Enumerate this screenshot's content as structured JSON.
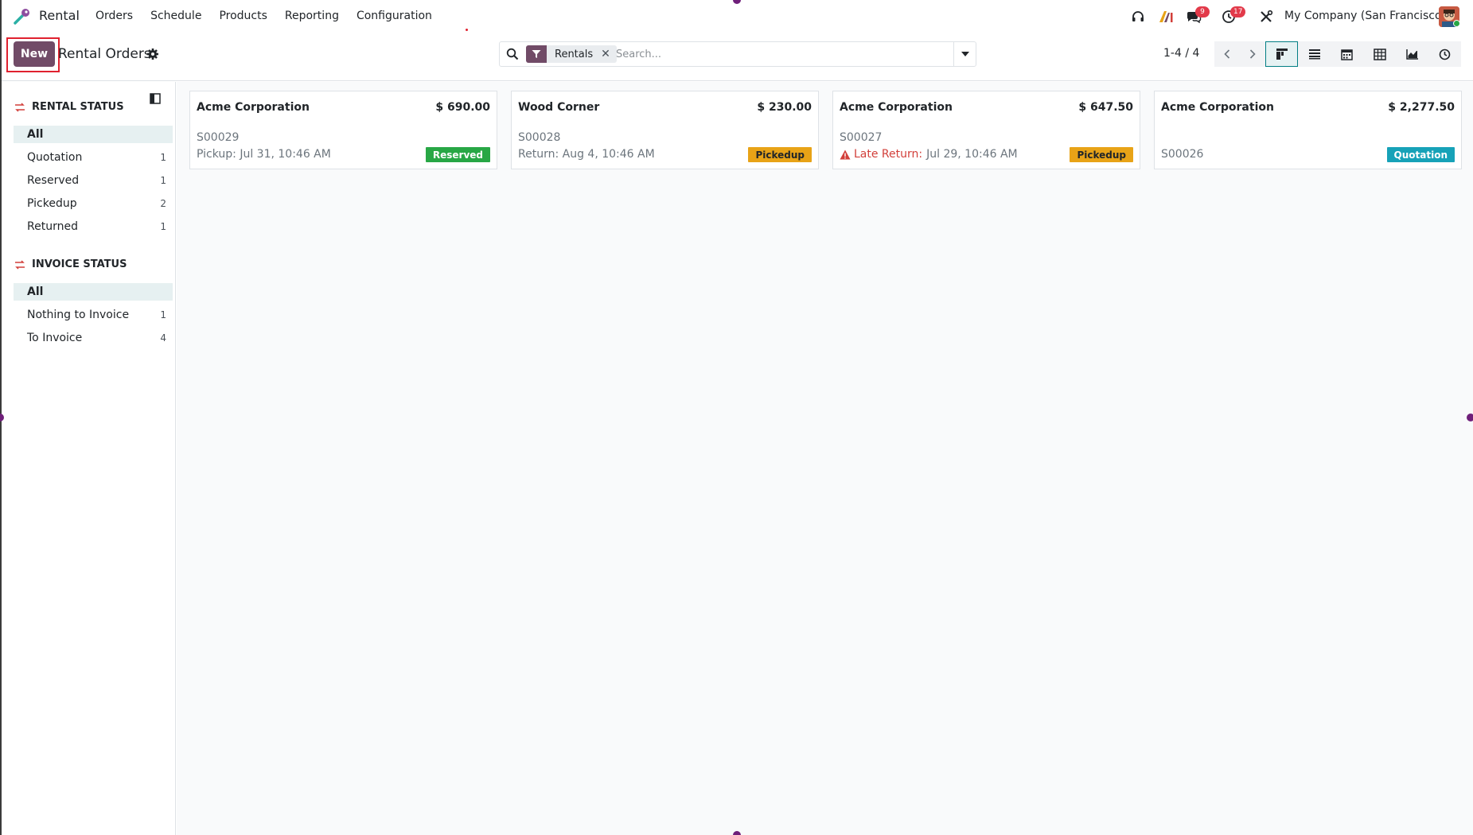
{
  "navbar": {
    "app_name": "Rental",
    "menu": [
      "Orders",
      "Schedule",
      "Products",
      "Reporting",
      "Configuration"
    ],
    "messages_badge": "9",
    "activities_badge": "17",
    "company": "My Company (San Francisco)"
  },
  "control": {
    "new_label": "New",
    "title": "Rental Orders",
    "search": {
      "facet_label": "Rentals",
      "placeholder": "Search..."
    },
    "pager": "1-4 / 4"
  },
  "sidebar": {
    "rental_status": {
      "title": "RENTAL STATUS",
      "items": [
        {
          "label": "All",
          "count": ""
        },
        {
          "label": "Quotation",
          "count": "1"
        },
        {
          "label": "Reserved",
          "count": "1"
        },
        {
          "label": "Pickedup",
          "count": "2"
        },
        {
          "label": "Returned",
          "count": "1"
        }
      ]
    },
    "invoice_status": {
      "title": "INVOICE STATUS",
      "items": [
        {
          "label": "All",
          "count": ""
        },
        {
          "label": "Nothing to Invoice",
          "count": "1"
        },
        {
          "label": "To Invoice",
          "count": "4"
        }
      ]
    }
  },
  "cards": [
    {
      "customer": "Acme Corporation",
      "amount": "$ 690.00",
      "ref": "S00029",
      "date_prefix": "",
      "date_text": "Pickup: Jul 31, 10:46 AM",
      "tag": "Reserved",
      "tag_color": "#28a745"
    },
    {
      "customer": "Wood Corner",
      "amount": "$ 230.00",
      "ref": "S00028",
      "date_prefix": "",
      "date_text": "Return: Aug 4, 10:46 AM",
      "tag": "Pickedup",
      "tag_color": "#e8a317"
    },
    {
      "customer": "Acme Corporation",
      "amount": "$ 647.50",
      "ref": "S00027",
      "date_prefix": "Late Return:",
      "date_text": "Jul 29, 10:46 AM",
      "tag": "Pickedup",
      "tag_color": "#e8a317"
    },
    {
      "customer": "Acme Corporation",
      "amount": "$ 2,277.50",
      "ref": "S00026",
      "date_prefix": "",
      "date_text": "",
      "tag": "Quotation",
      "tag_color": "#17a2b8"
    }
  ],
  "colors": {
    "brand": "#714b67",
    "accent": "#017e84",
    "danger": "#d23f3a"
  }
}
